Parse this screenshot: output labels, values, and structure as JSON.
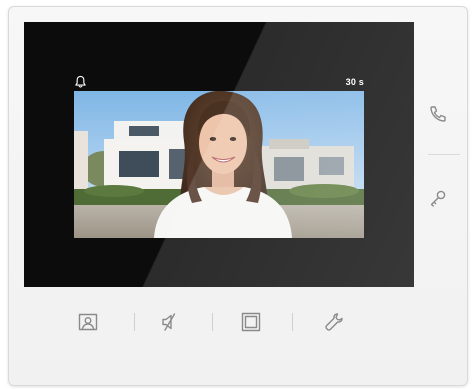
{
  "screen": {
    "timer": "30 s",
    "notification_icon": "bell-icon",
    "video_feed": "visitor-camera-feed"
  },
  "side_panel": {
    "buttons": [
      {
        "icon": "phone-icon",
        "name": "answer-call"
      },
      {
        "icon": "key-icon",
        "name": "open-door"
      }
    ]
  },
  "bottom_bar": {
    "buttons": [
      {
        "icon": "contact-photo-icon",
        "name": "camera-view"
      },
      {
        "icon": "mute-speaker-icon",
        "name": "mute"
      },
      {
        "icon": "square-icon",
        "name": "screen-toggle"
      },
      {
        "icon": "wrench-icon",
        "name": "settings"
      }
    ]
  },
  "colors": {
    "device_body": "#f4f4f4",
    "screen_bezel": "#0c0c0d",
    "icon_gray": "#8a8a8a",
    "status_text": "#ffffff"
  }
}
